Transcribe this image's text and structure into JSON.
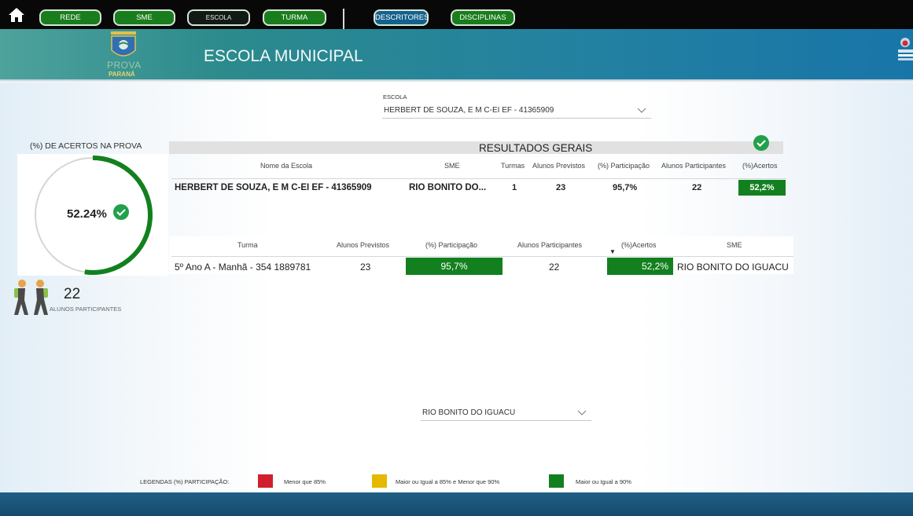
{
  "nav": {
    "rede": "REDE",
    "sme": "SME",
    "escola": "ESCOLA",
    "turma": "TURMA",
    "descritores": "DESCRITORES",
    "disciplinas": "DISCIPLINAS"
  },
  "logo": {
    "prova": "PROVA",
    "parana": "PARANÁ"
  },
  "page_title": "ESCOLA MUNICIPAL",
  "slicers": {
    "escola_label": "ESCOLA",
    "escola_value": "HERBERT DE SOUZA, E M C-EI EF - 41365909",
    "municipio_value": "RIO BONITO DO IGUACU"
  },
  "gauge": {
    "title": "(%) DE ACERTOS NA PROVA",
    "value_text": "52.24%",
    "value": 0.5224
  },
  "participants": {
    "count": "22",
    "label": "ALUNOS PARTICIPANTES"
  },
  "results": {
    "title": "RESULTADOS GERAIS",
    "headers": [
      "Nome da Escola",
      "SME",
      "Turmas",
      "Alunos Previstos",
      "(%) Participação",
      "Alunos Participantes",
      "(%)Acertos"
    ],
    "row": [
      "HERBERT DE SOUZA, E M C-EI EF - 41365909",
      "RIO BONITO DO...",
      "1",
      "23",
      "95,7%",
      "22",
      "52,2%"
    ]
  },
  "turma_table": {
    "headers": [
      "Turma",
      "Alunos Previstos",
      "(%) Participação",
      "Alunos Participantes",
      "(%)Acertos",
      "SME"
    ],
    "row": [
      "5º Ano A - Manhã - 354 1889781",
      "23",
      "95,7%",
      "22",
      "52,2%",
      "RIO BONITO DO IGUACU"
    ]
  },
  "legend": {
    "title": "LEGENDAS (%) PARTICIPAÇÃO:",
    "items": [
      {
        "label": "Menor que 85%",
        "color": "#d0202c"
      },
      {
        "label": "Maior ou Igual a 85% e Menor que 90%",
        "color": "#e6b800"
      },
      {
        "label": "Maior ou Igual a 90%",
        "color": "#13801f"
      }
    ]
  },
  "colors": {
    "accent_green": "#13801f",
    "nav_blue": "#14628c",
    "banner": "#2482a0"
  }
}
